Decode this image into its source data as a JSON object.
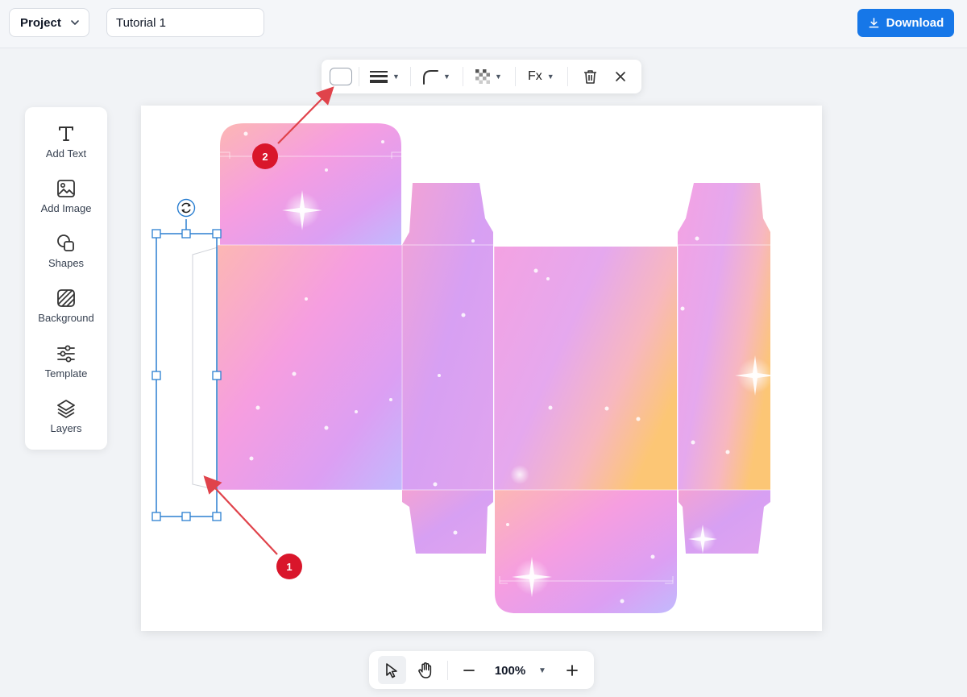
{
  "header": {
    "project_label": "Project",
    "project_name": "Tutorial 1",
    "download_label": "Download"
  },
  "tools": [
    {
      "id": "text",
      "label": "Add Text",
      "icon": "text-icon"
    },
    {
      "id": "image",
      "label": "Add Image",
      "icon": "image-icon"
    },
    {
      "id": "shapes",
      "label": "Shapes",
      "icon": "shapes-icon"
    },
    {
      "id": "background",
      "label": "Background",
      "icon": "background-icon"
    },
    {
      "id": "template",
      "label": "Template",
      "icon": "sliders-icon"
    },
    {
      "id": "layers",
      "label": "Layers",
      "icon": "layers-icon"
    }
  ],
  "context_toolbar": {
    "fill_color": "#ffffff",
    "effects_label": "Fx",
    "items": [
      "fill-swatch",
      "stroke-width-icon",
      "corner-radius-icon",
      "opacity-icon",
      "effects",
      "trash-icon",
      "close-icon"
    ]
  },
  "zoombar": {
    "zoom_level": "100%",
    "active_tool": "select"
  },
  "annotations": [
    {
      "label": "1"
    },
    {
      "label": "2"
    }
  ],
  "colors": {
    "accent": "#1677e8",
    "selection": "#2b7fd1",
    "badge": "#d9162b",
    "arrow": "#e0434b",
    "gradient": [
      "#fbb8c0",
      "#f79bdc",
      "#d59df5",
      "#c7b6ff",
      "#fcc877"
    ]
  }
}
